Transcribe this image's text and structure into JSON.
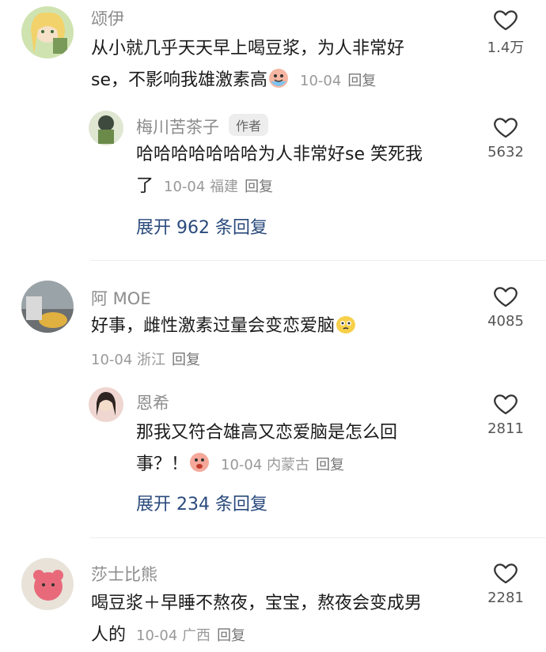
{
  "comments": [
    {
      "name": "颂伊",
      "text_line1": "从小就几乎天天早上喝豆浆，为人非常好",
      "text_line2": "se，不影响我雄激素高",
      "date": "10-04",
      "reply": "回复",
      "likes": "1.4万",
      "sub": {
        "name": "梅川苦茶子",
        "badge": "作者",
        "text_line1": "哈哈哈哈哈哈哈为人非常好se 笑死我",
        "text_line2": "了",
        "date": "10-04",
        "location": "福建",
        "reply": "回复",
        "likes": "5632"
      },
      "expand": "展开 962 条回复"
    },
    {
      "name": "阿 MOE",
      "text_line1": "好事，雌性激素过量会变恋爱脑",
      "date": "10-04",
      "location": "浙江",
      "reply": "回复",
      "likes": "4085",
      "sub": {
        "name": "恩希",
        "text_line1": "那我又符合雄高又恋爱脑是怎么回",
        "text_line2": "事？！",
        "date": "10-04",
        "location": "内蒙古",
        "reply": "回复",
        "likes": "2811"
      },
      "expand": "展开 234 条回复"
    },
    {
      "name": "莎士比熊",
      "text_line1": "喝豆浆＋早睡不熬夜，宝宝，熬夜会变成男",
      "text_line2": "人的",
      "date": "10-04",
      "location": "广西",
      "reply": "回复",
      "likes": "2281"
    }
  ],
  "icons": {
    "like": "heart-outline-icon"
  }
}
